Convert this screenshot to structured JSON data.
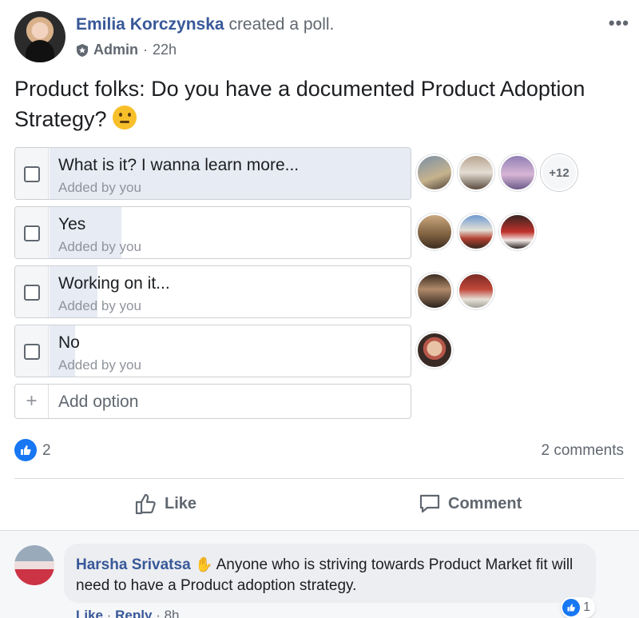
{
  "post": {
    "author": "Emilia Korczynska",
    "action": "created a poll.",
    "role": "Admin",
    "separator": "·",
    "time": "22h",
    "more_label": "•••",
    "text": "Product folks: Do you have a documented Product Adoption Strategy?",
    "emoji": "thinking-face"
  },
  "poll": {
    "options": [
      {
        "label": "What is it? I wanna learn more...",
        "added_by": "Added by you",
        "fill": 1.0,
        "voter_count_extra": "+12"
      },
      {
        "label": "Yes",
        "added_by": "Added by you",
        "fill": 0.2
      },
      {
        "label": "Working on it...",
        "added_by": "Added by you",
        "fill": 0.13
      },
      {
        "label": "No",
        "added_by": "Added by you",
        "fill": 0.07
      }
    ],
    "add_option_placeholder": "Add option"
  },
  "stats": {
    "likes": "2",
    "comments": "2 comments"
  },
  "actions": {
    "like": "Like",
    "comment": "Comment"
  },
  "comment": {
    "author": "Harsha Srivatsa",
    "text": "Anyone who is striving towards Product Market fit will need to have a Product adoption strategy.",
    "reaction_count": "1",
    "like_link": "Like",
    "reply_link": "Reply",
    "time": "8h"
  },
  "colors": {
    "link": "#385898",
    "fill": "#e7ebf3",
    "like_blue": "#1877f2"
  }
}
